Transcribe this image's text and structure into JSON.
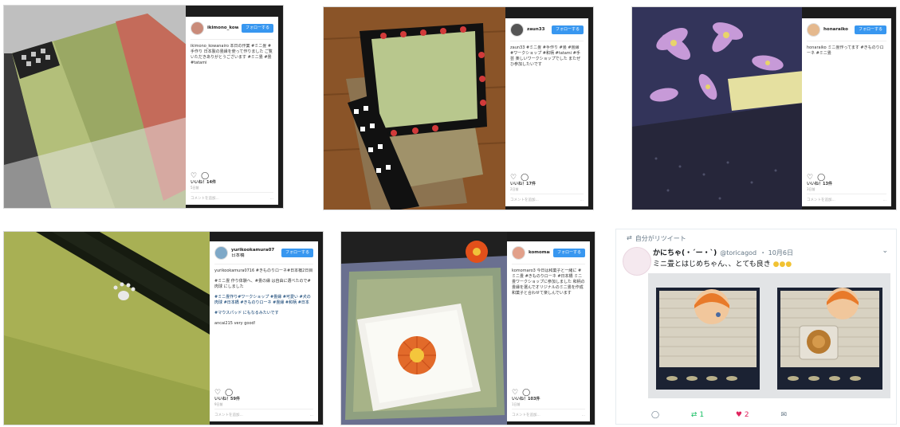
{
  "posts": [
    {
      "username": "ikimono_kowanairo",
      "follow_label": "フォローする",
      "caption": "ikimono_kowanairo 本日の作業 #ミニ畳 #手作り 日本製の畳縁を使って作りました ご覧いただきありがとうございます #ミニ畳 #畳 #tatami",
      "likes": "いいね！14件",
      "date": "5日前",
      "comment_placeholder": "コメントを追加...",
      "more": "..."
    },
    {
      "username": "zaun33",
      "follow_label": "フォローする",
      "caption": "zaun33 #ミニ畳 #手作り #畳 #畳縁 #ワークショップ #和柄 #tatami #手芸 楽しいワークショップでした またぜひ参加したいです",
      "likes": "いいね！17件",
      "date": "2日前",
      "comment_placeholder": "コメントを追加...",
      "more": "..."
    },
    {
      "username": "honaraiko",
      "follow_label": "フォローする",
      "caption": "honaraiko ミニ畳作ってます #きものりローネ #ミニ畳",
      "likes": "いいね！13件",
      "date": "3日前",
      "comment_placeholder": "コメントを追加...",
      "more": "..."
    },
    {
      "username": "yurikookamura07",
      "location": "日本橋",
      "follow_label": "フォローする",
      "caption_lines": [
        "yurikookamura0716 #きものりローネ#日本橋2日目",
        "#ミニ畳 作り体験へ、#畳の縁 は自由に選べたので#肉球 にしました",
        "#ミニ畳作り#ワークショップ #畳縁 #可愛い #犬の肉球 #日本橋 #きものりローネ #畳縁 #和柄 #日本",
        "#マウスパッド にもなるみたいです",
        "ancai215 very good!"
      ],
      "likes": "いいね！59件",
      "date": "9日前",
      "comment_placeholder": "コメントを追加...",
      "more": "..."
    },
    {
      "username": "komomaro3",
      "follow_label": "フォローする",
      "caption": "komomaro3 今日は和菓子と一緒に #ミニ畳 #きものりローネ #日本橋 ミニ畳ワークショップに参加しました 和柄の畳縁を選んでオリジナルのミニ畳を作成 和菓子と合わせて楽しんでいます",
      "likes": "いいね！103件",
      "date": "1日前",
      "comment_placeholder": "コメントを追加...",
      "more": "..."
    }
  ],
  "tweet": {
    "retweet_label": "自分がリツイート",
    "display_name": "かにちゃ(・´ー・`)",
    "handle": "@toricagod",
    "date": "・ 10月6日",
    "text": "ミニ畳とはじめちゃん、、とても良き",
    "reply_count": "",
    "retweet_count": "1",
    "like_count": "2"
  },
  "colors": {
    "follow_blue": "#3897f0",
    "like_red": "#e0245e",
    "retweet_green": "#17bf63",
    "twitter_gray": "#657786"
  }
}
